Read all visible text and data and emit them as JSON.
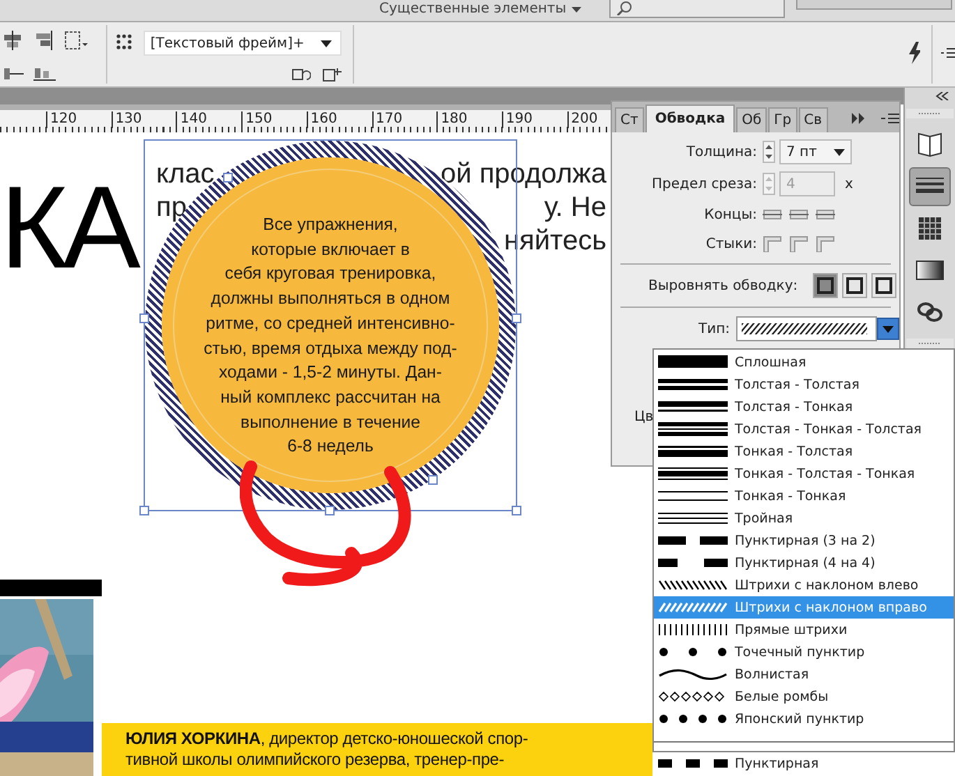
{
  "app_bar": {
    "workspace": "Существенные элементы"
  },
  "control_bar": {
    "style_field": "[Текстовый фрейм]+"
  },
  "ruler": {
    "labels": [
      "120",
      "130",
      "140",
      "150",
      "160",
      "170",
      "180",
      "190",
      "200"
    ]
  },
  "document": {
    "headline": "КА",
    "body_fragments": [
      {
        "text": "клас"
      },
      {
        "text": "ой продолжа"
      },
      {
        "text": "пр"
      },
      {
        "text": "у. Не"
      },
      {
        "text": "няйтесь"
      }
    ],
    "circle_text_lines": [
      "Все упражнения,",
      "которые включает в",
      "себя круговая тренировка,",
      "должны выполняться в одном",
      "ритме, со средней интенсивно-",
      "стью, время отдыха между под-",
      "ходами - 1,5-2 минуты. Дан-",
      "ный комплекс рассчитан на",
      "выполнение в течение",
      "6-8 недель"
    ],
    "caption": "**ЮЛИЯ ХОРКИНА**, директор детско-юношеской спор-",
    "caption_line2": "тивной школы олимпийского резерва, тренер-пре-"
  },
  "stroke_panel": {
    "tabs": [
      {
        "label": "Ст",
        "selected": false
      },
      {
        "label": "Обводка",
        "selected": true
      },
      {
        "label": "Об",
        "selected": false
      },
      {
        "label": "Гр",
        "selected": false
      },
      {
        "label": "Св",
        "selected": false
      }
    ],
    "weight_label": "Толщина:",
    "weight": "7 пт",
    "miter_label": "Предел среза:",
    "miter": "4",
    "miter_unit": "x",
    "miter_disabled": true,
    "caps_label": "Концы:",
    "joins_label": "Стыки:",
    "align_label": "Выровнять обводку:",
    "align_options": [
      {
        "selected": true
      },
      {
        "selected": false
      },
      {
        "selected": false
      }
    ],
    "type_label": "Тип:",
    "hidden_label": "Цв"
  },
  "type_menu": {
    "items": [
      {
        "label": "Сплошная",
        "kind": "solid",
        "selected": false
      },
      {
        "label": "Толстая - Толстая",
        "kind": "thick-thick",
        "selected": false
      },
      {
        "label": "Толстая - Тонкая",
        "kind": "thick-thin",
        "selected": false
      },
      {
        "label": "Толстая - Тонкая - Толстая",
        "kind": "thick-thin-thick",
        "selected": false
      },
      {
        "label": "Тонкая - Толстая",
        "kind": "thin-thick",
        "selected": false
      },
      {
        "label": "Тонкая - Толстая - Тонкая",
        "kind": "thin-thick-thin",
        "selected": false
      },
      {
        "label": "Тонкая - Тонкая",
        "kind": "thin-thin",
        "selected": false
      },
      {
        "label": "Тройная",
        "kind": "triple",
        "selected": false
      },
      {
        "label": "Пунктирная (3 на 2)",
        "kind": "dash32",
        "selected": false
      },
      {
        "label": "Пунктирная (4 на 4)",
        "kind": "dash44",
        "selected": false
      },
      {
        "label": "Штрихи с наклоном влево",
        "kind": "hatch-left",
        "selected": false
      },
      {
        "label": "Штрихи с наклоном вправо",
        "kind": "hatch-right",
        "selected": true
      },
      {
        "label": "Прямые штрихи",
        "kind": "straight-hatch",
        "selected": false
      },
      {
        "label": "Точечный пунктир",
        "kind": "dots",
        "selected": false
      },
      {
        "label": "Волнистая",
        "kind": "wavy",
        "selected": false
      },
      {
        "label": "Белые ромбы",
        "kind": "diamonds",
        "selected": false
      },
      {
        "label": "Японский пунктир",
        "kind": "japanese-dots",
        "selected": false
      },
      {
        "label": "Пунктирная",
        "kind": "dashed",
        "selected": false,
        "separated": true
      }
    ]
  },
  "dock": {
    "items": [
      {
        "kind": "pages",
        "selected": false
      },
      {
        "kind": "stroke",
        "selected": true
      },
      {
        "kind": "swatches",
        "selected": false
      },
      {
        "kind": "gradient",
        "selected": false
      },
      {
        "kind": "links",
        "selected": false
      }
    ]
  }
}
